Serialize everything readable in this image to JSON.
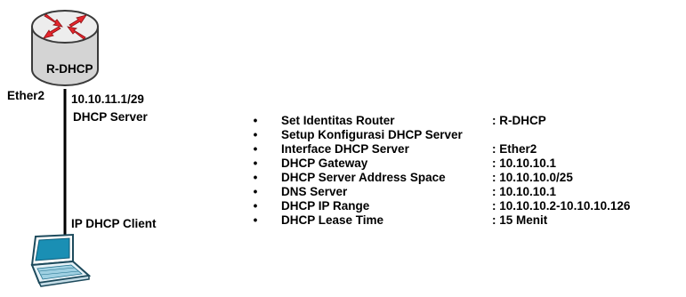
{
  "router": {
    "name": "R-DHCP",
    "interface": "Ether2",
    "ip": "10.10.11.1/29",
    "role": "DHCP Server",
    "icon": "router-icon"
  },
  "client": {
    "label": "IP DHCP Client",
    "icon": "laptop-icon"
  },
  "colors": {
    "router_body": "#d9d9d9",
    "router_arrows": "#e8262d",
    "laptop_screen": "#1a8fb4",
    "laptop_body": "#e6f2f8",
    "link": "#000000"
  },
  "config": [
    {
      "key": "Set Identitas Router",
      "value": "R-DHCP"
    },
    {
      "key": "Setup Konfigurasi  DHCP Server",
      "value": ""
    },
    {
      "key": "Interface DHCP Server",
      "value": "Ether2"
    },
    {
      "key": "DHCP Gateway",
      "value": "10.10.10.1"
    },
    {
      "key": "DHCP Server Address Space",
      "value": "10.10.10.0/25"
    },
    {
      "key": "DNS Server",
      "value": "10.10.10.1"
    },
    {
      "key": "DHCP IP Range",
      "value": "10.10.10.2-10.10.10.126"
    },
    {
      "key": "DHCP Lease Time",
      "value": "15 Menit"
    }
  ]
}
